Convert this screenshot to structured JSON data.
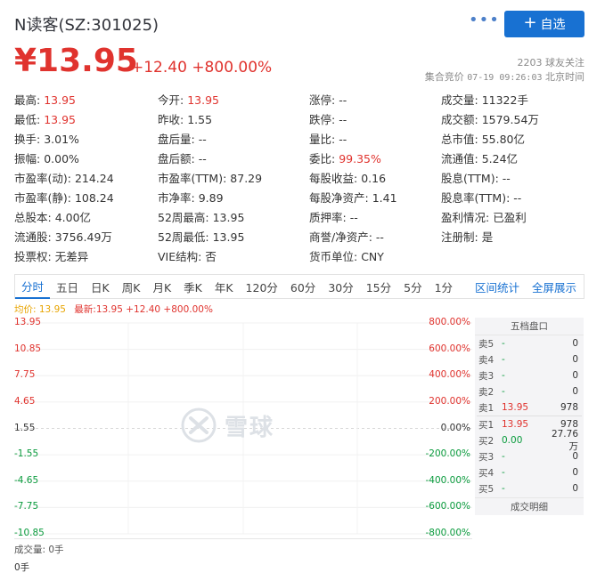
{
  "header": {
    "title": "N读客(SZ:301025)",
    "more_icon": "more-dots-icon",
    "add_button_label": "自选",
    "price": "¥13.95",
    "change": "+12.40 +800.00%",
    "follower_count": "2203",
    "follower_label": "球友关注",
    "status_text": "集合竞价",
    "timestamp": "07-19 09:26:03",
    "timezone_label": "北京时间"
  },
  "quote": {
    "rows": [
      [
        {
          "label": "最高:",
          "value": "13.95",
          "color": "red"
        },
        {
          "label": "今开:",
          "value": "13.95",
          "color": "red"
        },
        {
          "label": "涨停:",
          "value": "--",
          "color": ""
        },
        {
          "label": "成交量:",
          "value": "11322手",
          "color": ""
        }
      ],
      [
        {
          "label": "最低:",
          "value": "13.95",
          "color": "red"
        },
        {
          "label": "昨收:",
          "value": "1.55",
          "color": ""
        },
        {
          "label": "跌停:",
          "value": "--",
          "color": ""
        },
        {
          "label": "成交额:",
          "value": "1579.54万",
          "color": ""
        }
      ],
      [
        {
          "label": "换手:",
          "value": "3.01%",
          "color": ""
        },
        {
          "label": "盘后量:",
          "value": "--",
          "color": ""
        },
        {
          "label": "量比:",
          "value": "--",
          "color": ""
        },
        {
          "label": "总市值:",
          "value": "55.80亿",
          "color": ""
        }
      ],
      [
        {
          "label": "振幅:",
          "value": "0.00%",
          "color": ""
        },
        {
          "label": "盘后额:",
          "value": "--",
          "color": ""
        },
        {
          "label": "委比:",
          "value": "99.35%",
          "color": "red"
        },
        {
          "label": "流通值:",
          "value": "5.24亿",
          "color": ""
        }
      ],
      [
        {
          "label": "市盈率(动):",
          "value": "214.24",
          "color": ""
        },
        {
          "label": "市盈率(TTM):",
          "value": "87.29",
          "color": ""
        },
        {
          "label": "每股收益:",
          "value": "0.16",
          "color": ""
        },
        {
          "label": "股息(TTM):",
          "value": "--",
          "color": ""
        }
      ],
      [
        {
          "label": "市盈率(静):",
          "value": "108.24",
          "color": ""
        },
        {
          "label": "市净率:",
          "value": "9.89",
          "color": ""
        },
        {
          "label": "每股净资产:",
          "value": "1.41",
          "color": ""
        },
        {
          "label": "股息率(TTM):",
          "value": "--",
          "color": ""
        }
      ],
      [
        {
          "label": "总股本:",
          "value": "4.00亿",
          "color": ""
        },
        {
          "label": "52周最高:",
          "value": "13.95",
          "color": ""
        },
        {
          "label": "质押率:",
          "value": "--",
          "color": ""
        },
        {
          "label": "盈利情况:",
          "value": "已盈利",
          "color": ""
        }
      ],
      [
        {
          "label": "流通股:",
          "value": "3756.49万",
          "color": ""
        },
        {
          "label": "52周最低:",
          "value": "13.95",
          "color": ""
        },
        {
          "label": "商誉/净资产:",
          "value": "--",
          "color": ""
        },
        {
          "label": "注册制:",
          "value": "是",
          "color": ""
        }
      ],
      [
        {
          "label": "投票权:",
          "value": "无差异",
          "color": ""
        },
        {
          "label": "VIE结构:",
          "value": "否",
          "color": ""
        },
        {
          "label": "货币单位:",
          "value": "CNY",
          "color": ""
        },
        {
          "label": "",
          "value": "",
          "color": ""
        }
      ]
    ]
  },
  "tabs": {
    "items": [
      "分时",
      "五日",
      "日K",
      "周K",
      "月K",
      "季K",
      "年K",
      "120分",
      "60分",
      "30分",
      "15分",
      "5分",
      "1分"
    ],
    "active_index": 0,
    "right_links": [
      "区间统计",
      "全屏展示"
    ]
  },
  "legend": {
    "avg": "均价: 13.95",
    "latest": "最新:13.95 +12.40 +800.00%"
  },
  "chart_data": {
    "type": "line",
    "y_left_ticks": [
      "13.95",
      "10.85",
      "7.75",
      "4.65",
      "1.55",
      "-1.55",
      "-4.65",
      "-7.75",
      "-10.85"
    ],
    "y_right_ticks": [
      "800.00%",
      "600.00%",
      "400.00%",
      "200.00%",
      "0.00%",
      "-200.00%",
      "-400.00%",
      "-600.00%",
      "-800.00%"
    ],
    "ylim": [
      -10.85,
      13.95
    ],
    "base_price": 1.55,
    "series": []
  },
  "volume": {
    "label": "成交量: 0手",
    "zero_label": "0手"
  },
  "watermark": {
    "icon": "snowball-logo-icon",
    "text": "雪球"
  },
  "order_book": {
    "title": "五档盘口",
    "asks": [
      {
        "label": "卖5",
        "price": "-",
        "qty": "0"
      },
      {
        "label": "卖4",
        "price": "-",
        "qty": "0"
      },
      {
        "label": "卖3",
        "price": "-",
        "qty": "0"
      },
      {
        "label": "卖2",
        "price": "-",
        "qty": "0"
      },
      {
        "label": "卖1",
        "price": "13.95",
        "qty": "978"
      }
    ],
    "bids": [
      {
        "label": "买1",
        "price": "13.95",
        "qty": "978"
      },
      {
        "label": "买2",
        "price": "0.00",
        "qty": "27.76万"
      },
      {
        "label": "买3",
        "price": "-",
        "qty": "0"
      },
      {
        "label": "买4",
        "price": "-",
        "qty": "0"
      },
      {
        "label": "买5",
        "price": "-",
        "qty": "0"
      }
    ],
    "detail_label": "成交明细"
  },
  "colors": {
    "up": "#e0332e",
    "down": "#0a9b3d",
    "accent": "#1871d2",
    "avg_line": "#e8a400"
  }
}
